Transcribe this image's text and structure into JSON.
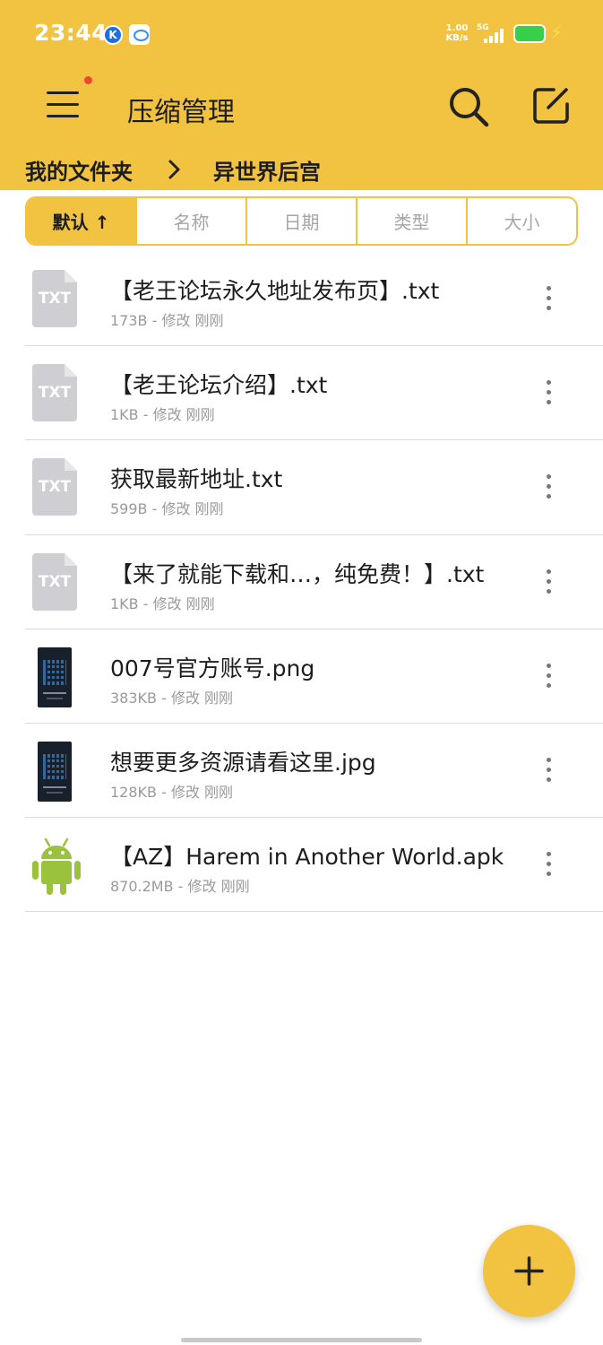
{
  "status_bar": {
    "time": "23:44",
    "app_icon_1": "K",
    "net_speed_value": "1.00",
    "net_speed_unit": "KB/s",
    "network_type": "5G"
  },
  "header": {
    "title": "压缩管理",
    "menu_icon": "hamburger-menu-icon",
    "search_icon": "search-icon",
    "edit_icon": "edit-icon",
    "notification_dot_color": "#f0452e",
    "background_color": "#f1c341"
  },
  "breadcrumb": {
    "items": [
      "我的文件夹",
      "异世界后宫"
    ]
  },
  "sort": {
    "tabs": [
      {
        "label": "默认 ↑",
        "active": true
      },
      {
        "label": "名称",
        "active": false
      },
      {
        "label": "日期",
        "active": false
      },
      {
        "label": "类型",
        "active": false
      },
      {
        "label": "大小",
        "active": false
      }
    ]
  },
  "files": [
    {
      "name": "【老王论坛永久地址发布页】.txt",
      "meta": "173B - 修改 刚刚",
      "type": "txt",
      "icon_label": "TXT"
    },
    {
      "name": "【老王论坛介绍】.txt",
      "meta": "1KB - 修改 刚刚",
      "type": "txt",
      "icon_label": "TXT"
    },
    {
      "name": "获取最新地址.txt",
      "meta": "599B - 修改 刚刚",
      "type": "txt",
      "icon_label": "TXT"
    },
    {
      "name": "【来了就能下载和…，纯免费！】.txt",
      "meta": "1KB - 修改 刚刚",
      "type": "txt",
      "icon_label": "TXT"
    },
    {
      "name": "007号官方账号.png",
      "meta": "383KB - 修改 刚刚",
      "type": "image"
    },
    {
      "name": "想要更多资源请看这里.jpg",
      "meta": "128KB - 修改 刚刚",
      "type": "image"
    },
    {
      "name": "【AZ】Harem in Another World.apk",
      "meta": "870.2MB - 修改 刚刚",
      "type": "apk"
    }
  ],
  "fab": {
    "icon": "plus-icon",
    "color": "#f1c341"
  }
}
